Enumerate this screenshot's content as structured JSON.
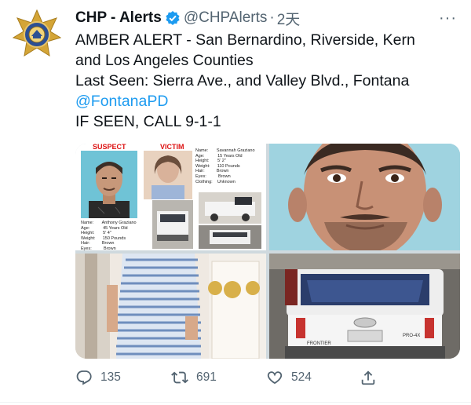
{
  "author": {
    "name": "CHP - Alerts",
    "handle": "@CHPAlerts",
    "separator": "·",
    "time": "2天",
    "verified": true,
    "avatar_icon": "chp-badge-logo"
  },
  "more_label": "···",
  "tweet": {
    "line1": "AMBER ALERT - San Bernardino, Riverside, Kern",
    "line2": "and Los Angeles Counties",
    "line3": "Last Seen: Sierra Ave., and Valley Blvd., Fontana",
    "mention": "@FontanaPD",
    "line5": "IF SEEN, CALL 9-1-1"
  },
  "flyer": {
    "suspect_label": "SUSPECT",
    "victim_label": "VICTIM",
    "suspect_info": "Name:       Anthony Graziano\nAge:           45 Years Old\nHeight:       5' 4\"\nWeight:      150 Pounds\nHair:          Brown\nEyes:          Brown\nClothing:    White shirt, dark shorts",
    "victim_info": "Name:       Savannah Graziano\nAge:           15 Years Old\nHeight:       5' 2\"\nWeight:      110 Pounds\nHair:          Brown\nEyes:          Brown\nClothing:    Unknown"
  },
  "truck": {
    "brand_text": "FRONTIER",
    "model_text": "PRO-4X"
  },
  "actions": {
    "replies": "135",
    "retweets": "691",
    "likes": "524"
  },
  "colors": {
    "accent": "#1d9bf0",
    "muted": "#536471",
    "text": "#0f1419"
  }
}
